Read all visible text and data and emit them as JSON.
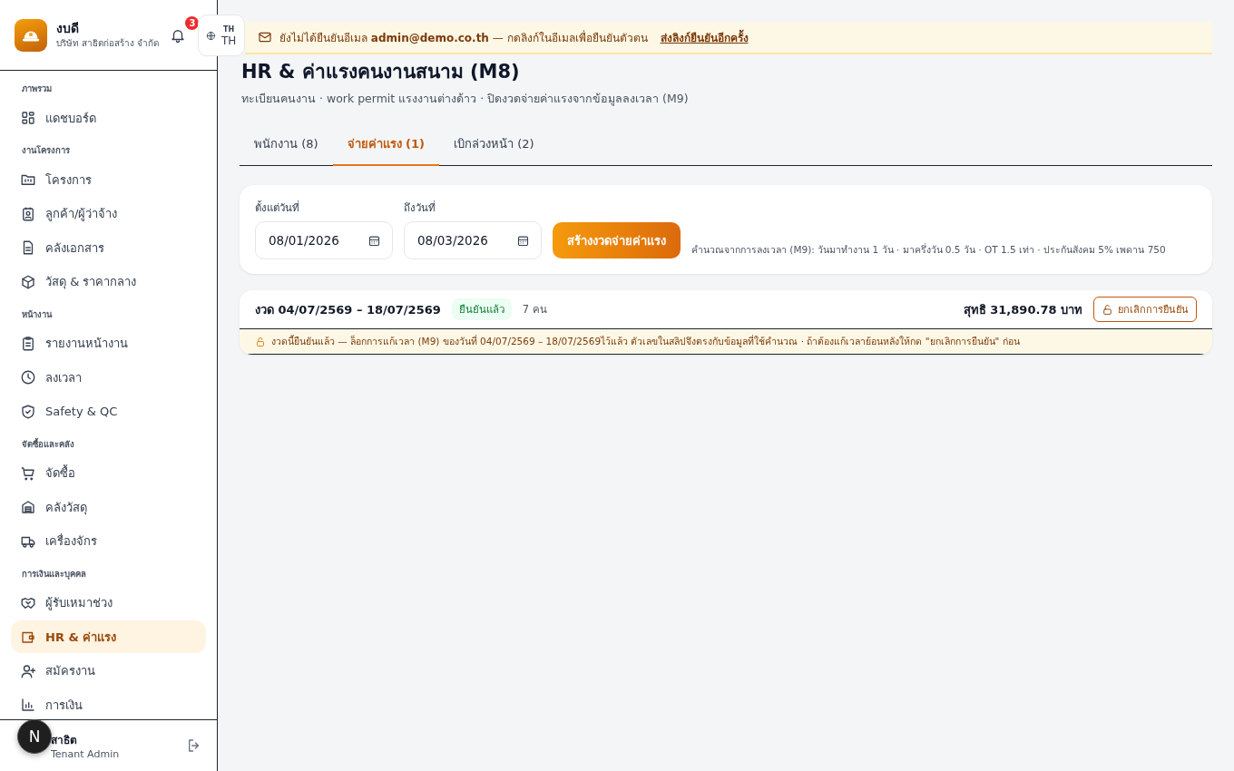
{
  "sidebar": {
    "brand": {
      "name": "งบดี",
      "company": "บริษัท สาธิตก่อสร้าง จำกัด"
    },
    "notifications": {
      "count": "3"
    },
    "language": {
      "small": "TH",
      "code": "TH"
    },
    "sections": [
      {
        "title": "ภาพรวม",
        "items": [
          {
            "label": "แดชบอร์ด",
            "selected": false
          }
        ]
      },
      {
        "title": "งานโครงการ",
        "items": [
          {
            "label": "โครงการ",
            "selected": false
          },
          {
            "label": "ลูกค้า/ผู้ว่าจ้าง",
            "selected": false
          },
          {
            "label": "คลังเอกสาร",
            "selected": false
          },
          {
            "label": "วัสดุ & ราคากลาง",
            "selected": false
          }
        ]
      },
      {
        "title": "หน้างาน",
        "items": [
          {
            "label": "รายงานหน้างาน",
            "selected": false
          },
          {
            "label": "ลงเวลา",
            "selected": false
          },
          {
            "label": "Safety & QC",
            "selected": false
          }
        ]
      },
      {
        "title": "จัดซื้อและคลัง",
        "items": [
          {
            "label": "จัดซื้อ",
            "selected": false
          },
          {
            "label": "คลังวัสดุ",
            "selected": false
          },
          {
            "label": "เครื่องจักร",
            "selected": false
          }
        ]
      },
      {
        "title": "การเงินและบุคคล",
        "items": [
          {
            "label": "ผู้รับเหมาช่วง",
            "selected": false
          },
          {
            "label": "HR & ค่าแรง",
            "selected": true
          },
          {
            "label": "สมัครงาน",
            "selected": false
          },
          {
            "label": "การเงิน",
            "selected": false
          }
        ]
      }
    ],
    "user": {
      "name": "สาธิต",
      "role": "Tenant Admin"
    }
  },
  "dev_badge": "N",
  "banner": {
    "text": "ยังไม่ได้ยืนยันอีเมล **admin@demo.co.th** — กดลิงก์ในอีเมลเพื่อยืนยันตัวตน",
    "link": "ส่งลิงก์ยืนยันอีกครั้ง"
  },
  "page": {
    "title": "HR & ค่าแรงคนงานสนาม (M8)",
    "subtitle": "ทะเบียนคนงาน · work permit แรงงานต่างด้าว · ปิดงวดจ่ายค่าแรงจากข้อมูลลงเวลา (M9)"
  },
  "tabs": [
    {
      "label": "พนักงาน (8)",
      "selected": false
    },
    {
      "label": "จ่ายค่าแรง (1)",
      "selected": true
    },
    {
      "label": "เบิกล่วงหน้า (2)",
      "selected": false
    }
  ],
  "filter": {
    "from_label": "ตั้งแต่วันที่",
    "from_value": "08/01/2026",
    "to_label": "ถึงวันที่",
    "to_value": "08/03/2026",
    "button": "สร้างงวดจ่ายค่าแรง",
    "note": "คำนวณจากการลงเวลา (M9): วันมาทำงาน 1 วัน · มาครึ่งวัน 0.5 วัน · OT 1.5 เท่า · ประกันสังคม 5% เพดาน 750"
  },
  "periods": [
    {
      "title": "งวด 04/07/2569 – 18/07/2569",
      "status": "ยืนยันแล้ว",
      "count": "7 คน",
      "net": "สุทธิ 31,890.78 บาท",
      "action": "ยกเลิกการยืนยัน",
      "notice": "งวดนี้ยืนยันแล้ว — ล็อกการแก้เวลา (M9) ของวันที่ 04/07/2569 – 18/07/2569ไว้แล้ว ตัวเลขในสลิปจึงตรงกับข้อมูลที่ใช้คำนวณ · ถ้าต้องแก้เวลาย้อนหลังให้กด \"ยกเลิกการยืนยัน\" ก่อน"
    }
  ]
}
